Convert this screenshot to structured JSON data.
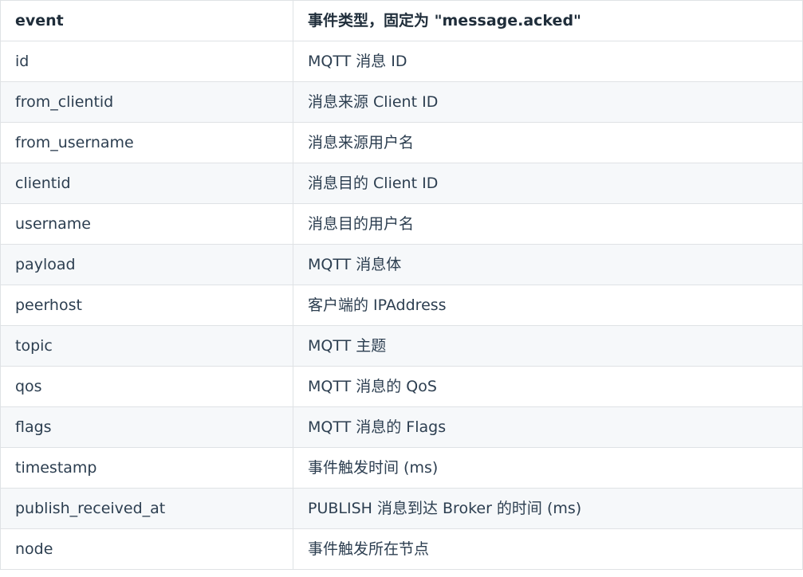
{
  "table": {
    "header": {
      "field": "event",
      "description": "事件类型，固定为 \"message.acked\""
    },
    "rows": [
      {
        "field": "id",
        "description": "MQTT 消息 ID"
      },
      {
        "field": "from_clientid",
        "description": "消息来源 Client ID"
      },
      {
        "field": "from_username",
        "description": "消息来源用户名"
      },
      {
        "field": "clientid",
        "description": "消息目的 Client ID"
      },
      {
        "field": "username",
        "description": "消息目的用户名"
      },
      {
        "field": "payload",
        "description": "MQTT 消息体"
      },
      {
        "field": "peerhost",
        "description": "客户端的 IPAddress"
      },
      {
        "field": "topic",
        "description": "MQTT 主题"
      },
      {
        "field": "qos",
        "description": "MQTT 消息的 QoS"
      },
      {
        "field": "flags",
        "description": "MQTT 消息的 Flags"
      },
      {
        "field": "timestamp",
        "description": "事件触发时间 (ms)"
      },
      {
        "field": "publish_received_at",
        "description": "PUBLISH 消息到达 Broker 的时间 (ms)"
      },
      {
        "field": "node",
        "description": "事件触发所在节点"
      }
    ]
  }
}
